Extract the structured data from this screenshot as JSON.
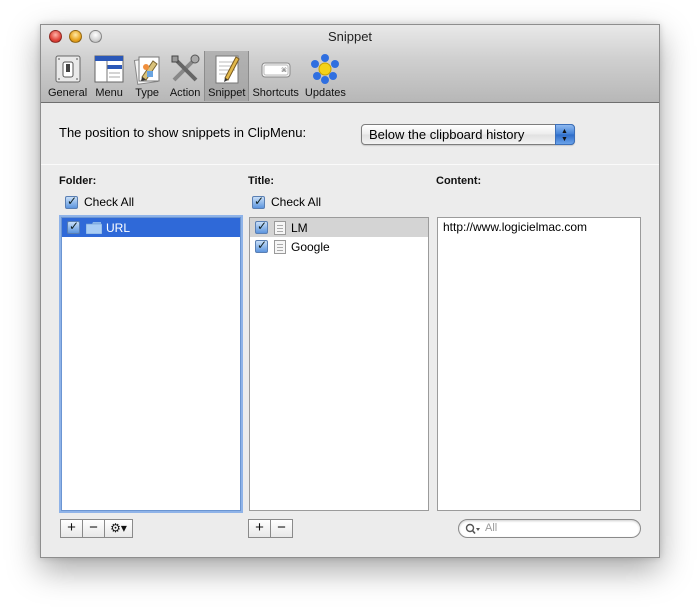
{
  "window": {
    "title": "Snippet"
  },
  "toolbar": {
    "items": [
      {
        "label": "General",
        "icon": "general-switch-icon"
      },
      {
        "label": "Menu",
        "icon": "menu-icon"
      },
      {
        "label": "Type",
        "icon": "type-icon"
      },
      {
        "label": "Action",
        "icon": "action-tools-icon"
      },
      {
        "label": "Snippet",
        "icon": "snippet-icon",
        "selected": true
      },
      {
        "label": "Shortcuts",
        "icon": "keyboard-icon"
      },
      {
        "label": "Updates",
        "icon": "updates-icon"
      }
    ]
  },
  "position": {
    "label": "The position to show snippets in ClipMenu:",
    "selected_option": "Below the clipboard history"
  },
  "folder": {
    "header": "Folder:",
    "check_all": "Check All",
    "items": [
      {
        "name": "URL",
        "checked": true,
        "selected": true
      }
    ]
  },
  "title": {
    "header": "Title:",
    "check_all": "Check All",
    "items": [
      {
        "name": "LM",
        "checked": true,
        "selected": true
      },
      {
        "name": "Google",
        "checked": true
      }
    ]
  },
  "content": {
    "header": "Content:",
    "text": "http://www.logicielmac.com"
  },
  "buttons": {
    "add": "+",
    "remove": "−",
    "action": "⚙▾"
  },
  "search": {
    "placeholder": "All"
  },
  "colors": {
    "selection": "#2f69d8",
    "accent_blue": "#3f7fd6"
  }
}
